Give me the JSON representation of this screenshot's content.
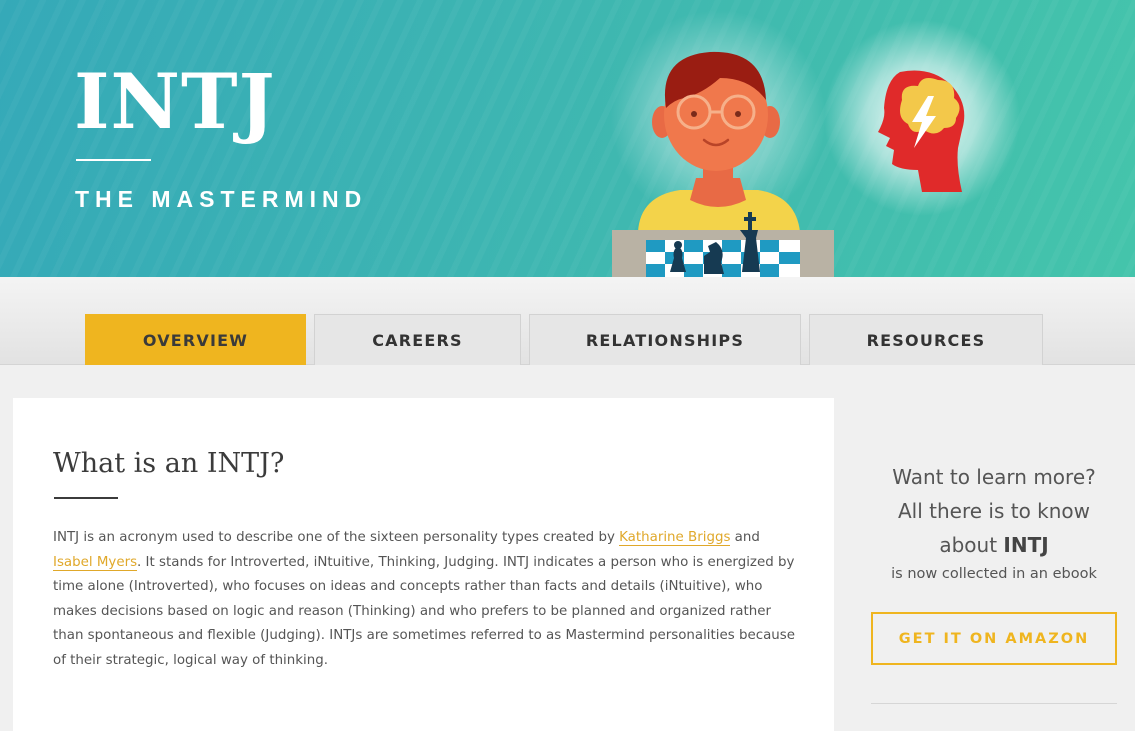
{
  "hero": {
    "type_code": "INTJ",
    "type_name": "THE MASTERMIND"
  },
  "tabs": [
    {
      "label": "OVERVIEW",
      "active": true
    },
    {
      "label": "CAREERS",
      "active": false
    },
    {
      "label": "RELATIONSHIPS",
      "active": false
    },
    {
      "label": "RESOURCES",
      "active": false
    }
  ],
  "article": {
    "heading": "What is an INTJ?",
    "text_1": "INTJ is an acronym used to describe one of the sixteen personality types created by ",
    "link_1": "Katharine Briggs",
    "text_2": " and ",
    "link_2": "Isabel Myers",
    "text_3": ". It stands for Introverted, iNtuitive, Thinking, Judging. INTJ indicates a person who is energized by time alone (Introverted), who focuses on ideas and concepts rather than facts and details (iNtuitive), who makes decisions based on logic and reason (Thinking) and who prefers to be planned and organized rather than spontaneous and flexible (Judging). INTJs are sometimes referred to as Mastermind personalities because of their strategic, logical way of thinking."
  },
  "sidebar": {
    "line_1": "Want to learn more?",
    "line_2": "All there is to know",
    "line_3_prefix": "about ",
    "line_3_bold": "INTJ",
    "sub": "is now collected in an ebook",
    "button_label": "GET IT ON AMAZON"
  },
  "colors": {
    "hero_teal": "#3fb8b0",
    "accent_yellow": "#efb51f",
    "link_gold": "#e0a82a",
    "brain_red": "#e02a2a"
  },
  "icons": [
    "mastermind-illustration",
    "brain-bolt-icon",
    "chessboard"
  ]
}
